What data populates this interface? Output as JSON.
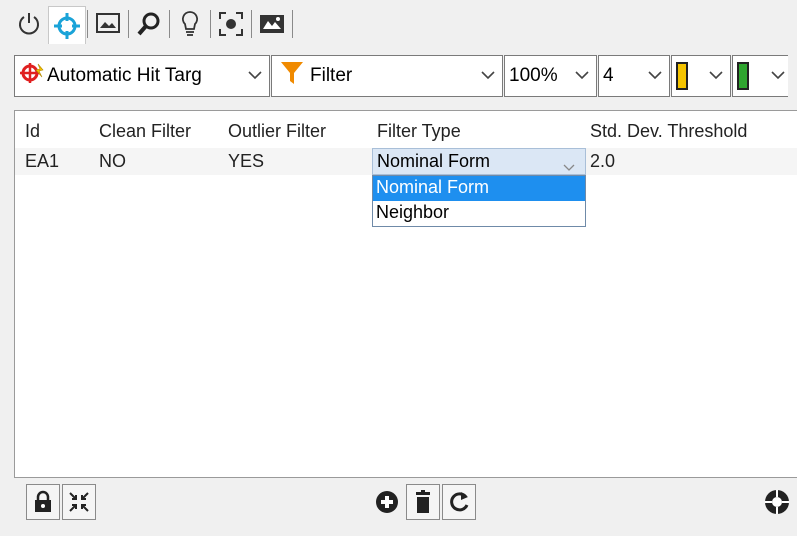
{
  "top_toolbar": {
    "icons": [
      "power-icon",
      "crosshair-target-icon",
      "image-frame-icon",
      "zoom-icon",
      "lightbulb-icon",
      "focus-frame-icon",
      "image-tools-icon"
    ],
    "active_index": 1,
    "active_color": "#1aa3d8"
  },
  "combo_bar": {
    "mode": {
      "label": "Automatic Hit Targ",
      "icon": "hit-target-icon"
    },
    "filter": {
      "label": "Filter",
      "icon": "funnel-icon"
    },
    "zoom": {
      "value": "100%"
    },
    "size": {
      "value": "4"
    },
    "color1": {
      "swatch": "#f5c400"
    },
    "color2": {
      "swatch": "#2fa52f"
    }
  },
  "grid": {
    "columns": [
      "Id",
      "Clean Filter",
      "Outlier Filter",
      "Filter Type",
      "Std. Dev. Threshold"
    ],
    "rows": [
      {
        "id": "EA1",
        "clean_filter": "NO",
        "outlier_filter": "YES",
        "filter_type": "Nominal Form",
        "std_dev_threshold": "2.0"
      }
    ],
    "filter_type_options": [
      "Nominal Form",
      "Neighbor"
    ],
    "selected_option": "Nominal Form"
  },
  "bottom_bar": {
    "left_icons": [
      "lock-icon",
      "collapse-icon"
    ],
    "center_icons": [
      "add-icon",
      "delete-icon",
      "refresh-icon"
    ],
    "right_icons": [
      "color-wheel-icon"
    ]
  }
}
